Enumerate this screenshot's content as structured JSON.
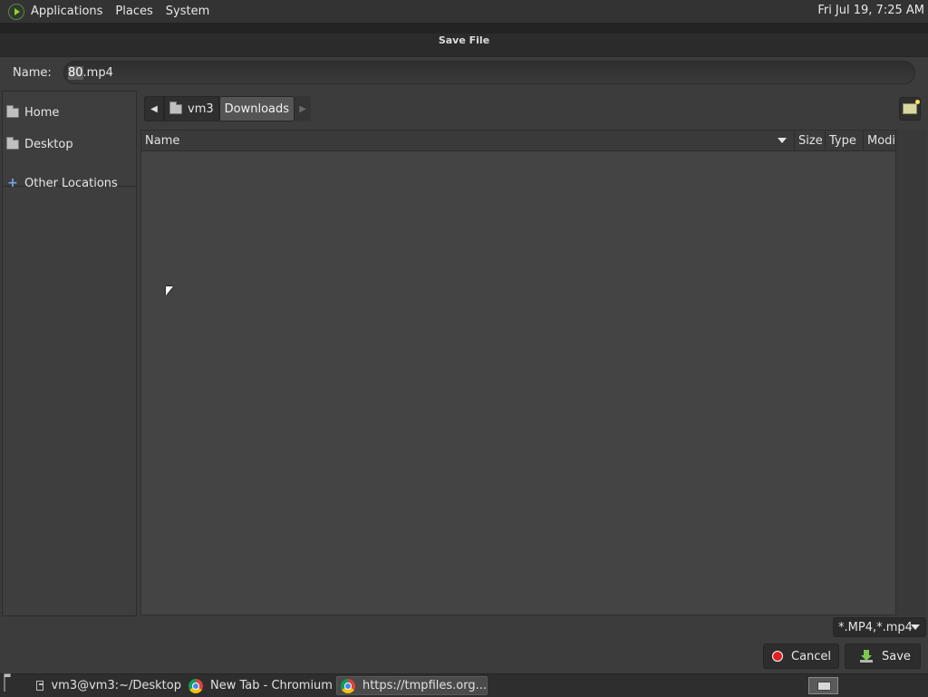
{
  "top_panel": {
    "menus": [
      "Applications",
      "Places",
      "System"
    ],
    "clock": "Fri Jul 19,  7:25 AM"
  },
  "dialog": {
    "title": "Save File",
    "name_label": "Name:",
    "filename_selected": "80",
    "filename_rest": ".mp4"
  },
  "sidebar": {
    "items": [
      {
        "label": "Home",
        "icon": "home-folder-icon"
      },
      {
        "label": "Desktop",
        "icon": "desktop-folder-icon"
      },
      {
        "label": "Other Locations",
        "icon": "plus-icon"
      }
    ]
  },
  "pathbar": {
    "segments": [
      "vm3",
      "Downloads"
    ],
    "active": "Downloads"
  },
  "file_list": {
    "columns": [
      "Name",
      "Size",
      "Type",
      "Modif"
    ],
    "sort_column": "Name",
    "rows": []
  },
  "filter": {
    "selected": "*.MP4,*.mp4"
  },
  "buttons": {
    "cancel": "Cancel",
    "save": "Save"
  },
  "taskbar": {
    "tasks": [
      {
        "label": "vm3@vm3:~/Desktop",
        "icon": "terminal-icon"
      },
      {
        "label": "New Tab - Chromium",
        "icon": "chromium-icon"
      },
      {
        "label": "https://tmpfiles.org...",
        "icon": "chromium-icon",
        "active": true
      }
    ]
  },
  "colors": {
    "accent_red": "#e02020",
    "save_green": "#7ec850",
    "link_blue": "#6ea8e8"
  }
}
